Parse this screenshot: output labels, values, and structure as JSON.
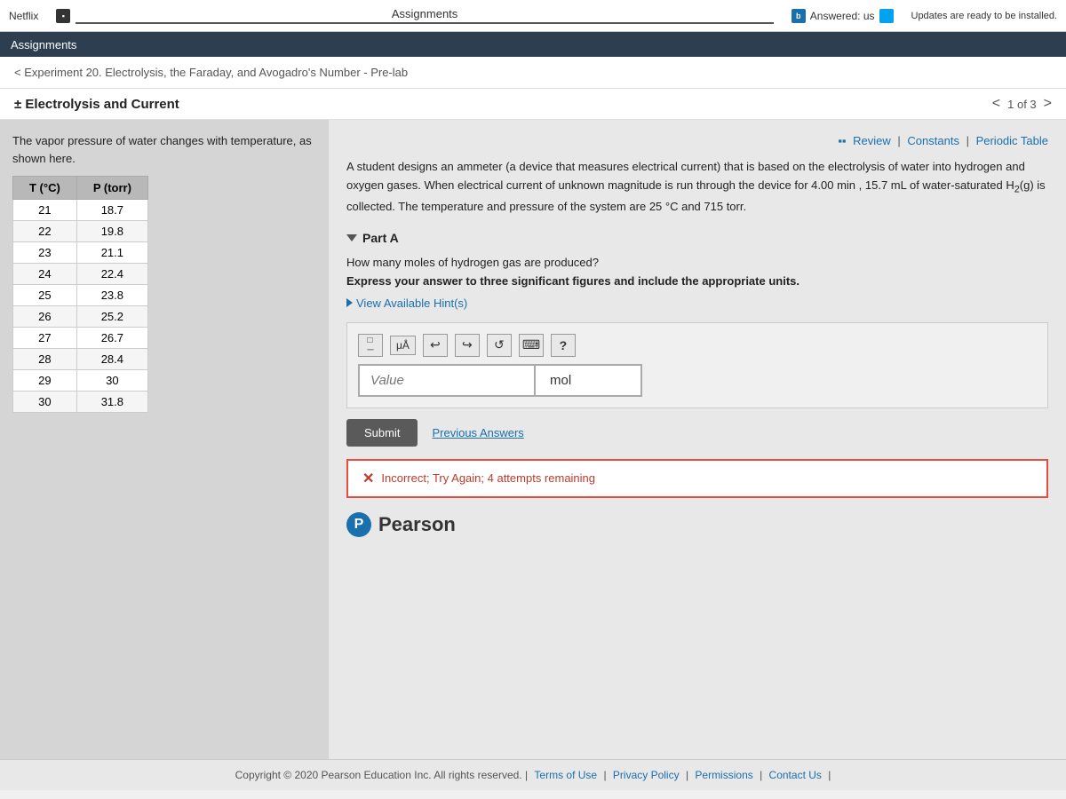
{
  "topbar": {
    "netflix_label": "Netflix",
    "assignments_label": "Assignments",
    "answered_label": "Answered: us",
    "update_label": "Updates are ready to be installed.",
    "tab_icon": "▪",
    "b_icon": "b"
  },
  "secondbar": {
    "label": "Assignments"
  },
  "breadcrumb": {
    "link": "< Experiment 20. Electrolysis, the Faraday, and Avogadro's Number - Pre-lab"
  },
  "section_header": {
    "title": "± Electrolysis and Current",
    "page_indicator": "1 of 3"
  },
  "left_panel": {
    "description": "The vapor pressure of water changes with temperature, as shown here.",
    "table_headers": [
      "T (°C)",
      "P (torr)"
    ],
    "table_rows": [
      [
        21,
        18.7
      ],
      [
        22,
        19.8
      ],
      [
        23,
        21.1
      ],
      [
        24,
        22.4
      ],
      [
        25,
        23.8
      ],
      [
        26,
        25.2
      ],
      [
        27,
        26.7
      ],
      [
        28,
        28.4
      ],
      [
        29,
        30.0
      ],
      [
        30,
        31.8
      ]
    ]
  },
  "right_panel": {
    "review_bar": "Review | Constants | Periodic Table",
    "question_text": "A student designs an ammeter (a device that measures electrical current) that is based on the electrolysis of water into hydrogen and oxygen gases. When electrical current of unknown magnitude is run through the device for 4.00 min , 15.7 mL of water-saturated H₂(g) is collected. The temperature and pressure of the system are 25 °C and 715 torr.",
    "part_a_label": "Part A",
    "subquestion": "How many moles of hydrogen gas are produced?",
    "sig_fig_instruction": "Express your answer to three significant figures and include the appropriate units.",
    "hint_link": "View Available Hint(s)",
    "value_placeholder": "Value",
    "unit_label": "mol",
    "submit_label": "Submit",
    "prev_answers_label": "Previous Answers",
    "incorrect_message": "Incorrect; Try Again; 4 attempts remaining",
    "pearson_label": "Pearson"
  },
  "footer": {
    "copyright": "Copyright © 2020 Pearson Education Inc. All rights reserved.",
    "terms": "Terms of Use",
    "privacy": "Privacy Policy",
    "permissions": "Permissions",
    "contact": "Contact Us"
  }
}
